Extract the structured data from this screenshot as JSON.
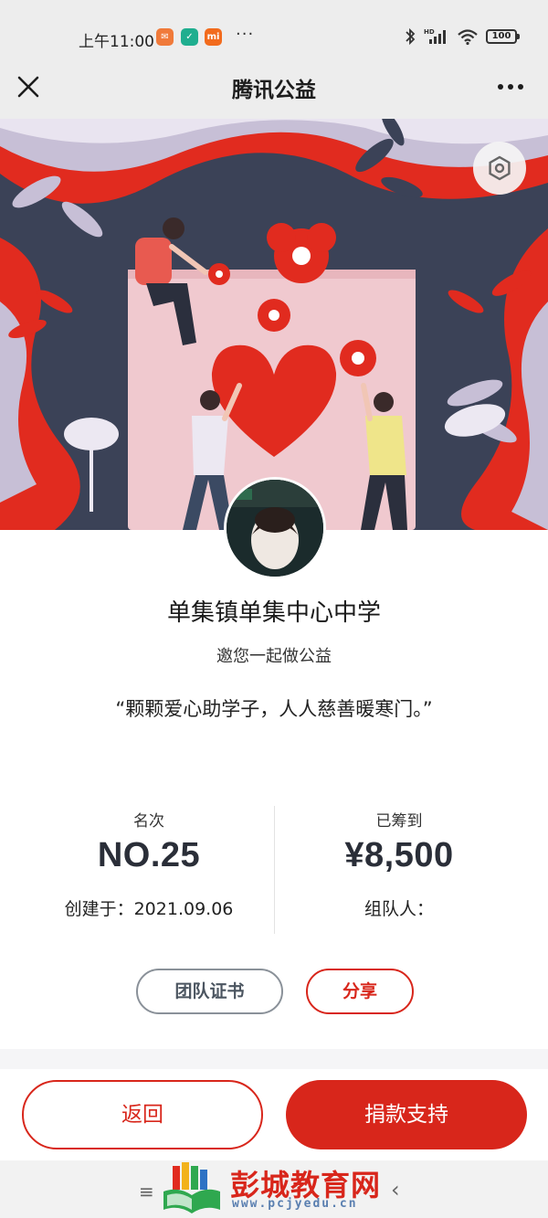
{
  "status_bar": {
    "time": "上午11:00",
    "app_icons": [
      {
        "name": "orange-app-icon",
        "color": "#f07a3a",
        "glyph": "✉"
      },
      {
        "name": "teal-app-icon",
        "color": "#1fae8f",
        "glyph": "✓"
      },
      {
        "name": "mi-app-icon",
        "color": "#f26b1d",
        "glyph": "mi"
      }
    ],
    "more_dots": "···",
    "signal_tag": "HD",
    "battery": "100"
  },
  "titlebar": {
    "title": "腾讯公益"
  },
  "hero": {
    "colors": {
      "red": "#e12b1f",
      "slate": "#3b4257",
      "lavender": "#c7bfd6",
      "pink": "#f0c9cf"
    }
  },
  "profile": {
    "org_name": "单集镇单集中心中学",
    "invite_text": "邀您一起做公益",
    "slogan": "“颗颗爱心助学子，人人慈善暖寒门。”"
  },
  "stats": {
    "rank_label": "名次",
    "rank_value": "NO.25",
    "created": "创建于：2021.09.06",
    "raised_label": "已筹到",
    "raised_value": "¥8,500",
    "organizer": "组队人："
  },
  "actions": {
    "certificate": "团队证书",
    "share": "分享"
  },
  "bottom": {
    "back": "返回",
    "donate": "捐款支持"
  },
  "nav": {
    "menu": "≡",
    "back": "‹"
  },
  "watermark": {
    "text": "彭城教育网",
    "url": "www.pcjyedu.cn"
  },
  "colors": {
    "accent": "#d8261b",
    "pill_border": "#8a9199",
    "background": "#f5f5f7"
  }
}
